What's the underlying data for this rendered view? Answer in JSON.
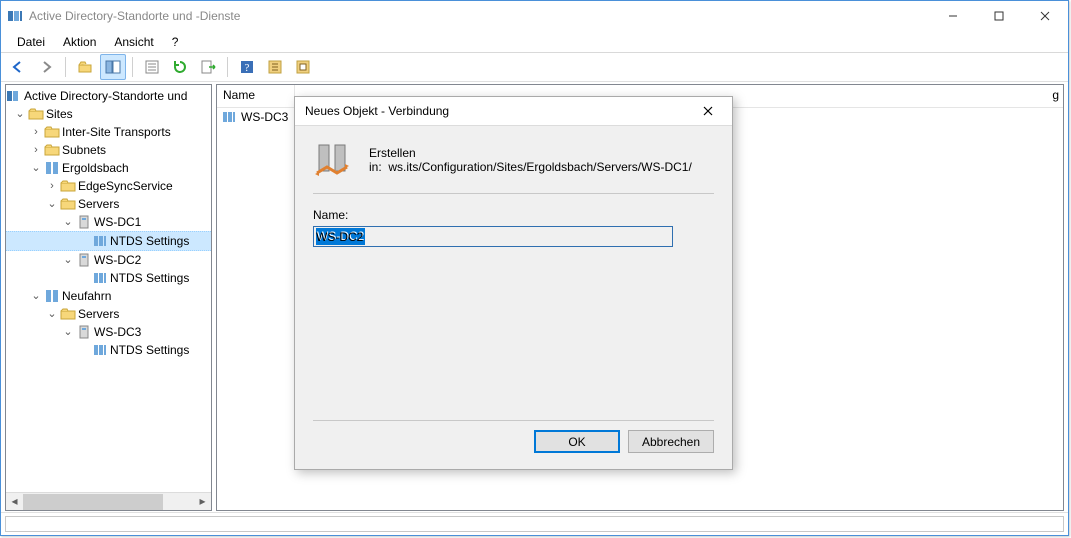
{
  "window": {
    "title": "Active Directory-Standorte und -Dienste"
  },
  "menu": {
    "items": [
      "Datei",
      "Aktion",
      "Ansicht",
      "?"
    ]
  },
  "toolbar": {
    "buttons": [
      {
        "name": "back-icon"
      },
      {
        "name": "forward-icon"
      },
      {
        "name": "up-icon"
      },
      {
        "name": "show-hide-tree-icon",
        "active": true
      },
      {
        "name": "export-list-icon"
      },
      {
        "name": "refresh-icon"
      },
      {
        "name": "export-icon"
      },
      {
        "name": "help-icon"
      },
      {
        "name": "prop-icon"
      },
      {
        "name": "prop2-icon"
      }
    ]
  },
  "tree": {
    "root": "Active Directory-Standorte und",
    "nodes": {
      "sites": "Sites",
      "ist": "Inter-Site Transports",
      "subnets": "Subnets",
      "ergoldsbach": "Ergoldsbach",
      "edgesync": "EdgeSyncService",
      "servers1": "Servers",
      "wsdc1": "WS-DC1",
      "ntds1": "NTDS Settings",
      "wsdc2": "WS-DC2",
      "ntds2": "NTDS Settings",
      "neufahrn": "Neufahrn",
      "servers2": "Servers",
      "wsdc3": "WS-DC3",
      "ntds3": "NTDS Settings"
    }
  },
  "list": {
    "columns": [
      "Name"
    ],
    "rows": [
      {
        "icon": "server",
        "label": "WS-DC3"
      }
    ],
    "partial_right": "g"
  },
  "dialog": {
    "title": "Neues Objekt - Verbindung",
    "create_in_label": "Erstellen in:",
    "create_in_path": "ws.its/Configuration/Sites/Ergoldsbach/Servers/WS-DC1/",
    "name_label": "Name:",
    "name_value": "WS-DC2",
    "ok_label": "OK",
    "cancel_label": "Abbrechen"
  }
}
